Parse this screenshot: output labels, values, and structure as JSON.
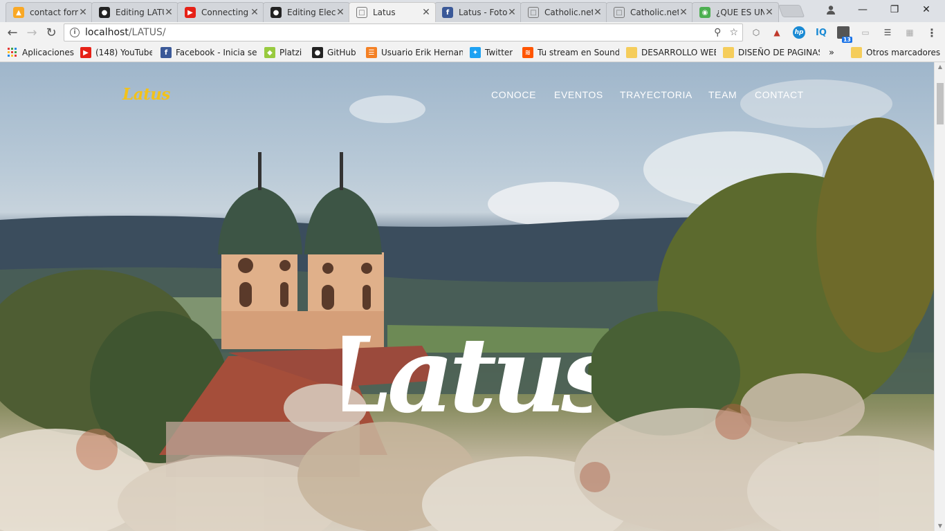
{
  "browser": {
    "tabs": [
      {
        "title": "contact form",
        "icon": "flame-icon",
        "color": "#f9a825"
      },
      {
        "title": "Editing LATUS",
        "icon": "github-icon",
        "color": "#222222"
      },
      {
        "title": "Connecting",
        "icon": "youtube-icon",
        "color": "#e62117"
      },
      {
        "title": "Editing Electr",
        "icon": "github-icon",
        "color": "#222222"
      },
      {
        "title": "Latus",
        "icon": "page-icon",
        "color": "#777777",
        "active": true
      },
      {
        "title": "Latus - Foto",
        "icon": "facebook-icon",
        "color": "#3b5998"
      },
      {
        "title": "Catholic.net",
        "icon": "page-icon",
        "color": "#777777"
      },
      {
        "title": "Catholic.net",
        "icon": "page-icon",
        "color": "#777777"
      },
      {
        "title": "¿QUE ES UN",
        "icon": "green-circle-icon",
        "color": "#4caf50"
      }
    ],
    "url_host": "localhost",
    "url_path": "/LATUS/",
    "extension_badge": "13"
  },
  "bookmarks": {
    "apps_label": "Aplicaciones",
    "items": [
      {
        "label": "(148) YouTube",
        "icon": "youtube-icon"
      },
      {
        "label": "Facebook - Inicia ses",
        "icon": "facebook-icon"
      },
      {
        "label": "Platzi",
        "icon": "platzi-icon"
      },
      {
        "label": "GitHub",
        "icon": "github-icon"
      },
      {
        "label": "Usuario Erik Hernand",
        "icon": "stackoverflow-icon"
      },
      {
        "label": "Twitter",
        "icon": "twitter-icon"
      },
      {
        "label": "Tu stream en Sound",
        "icon": "soundcloud-icon"
      },
      {
        "label": "DESARROLLO WEB",
        "icon": "folder-icon"
      },
      {
        "label": "DISEÑO DE PAGINAS",
        "icon": "folder-icon"
      }
    ],
    "overflow": "»",
    "other_label": "Otros marcadores"
  },
  "site": {
    "logo": "Latus",
    "nav": [
      "CONOCE",
      "EVENTOS",
      "TRAYECTORIA",
      "TEAM",
      "CONTACT"
    ],
    "hero_title": "Latus",
    "brand_color": "#f2c21b"
  }
}
